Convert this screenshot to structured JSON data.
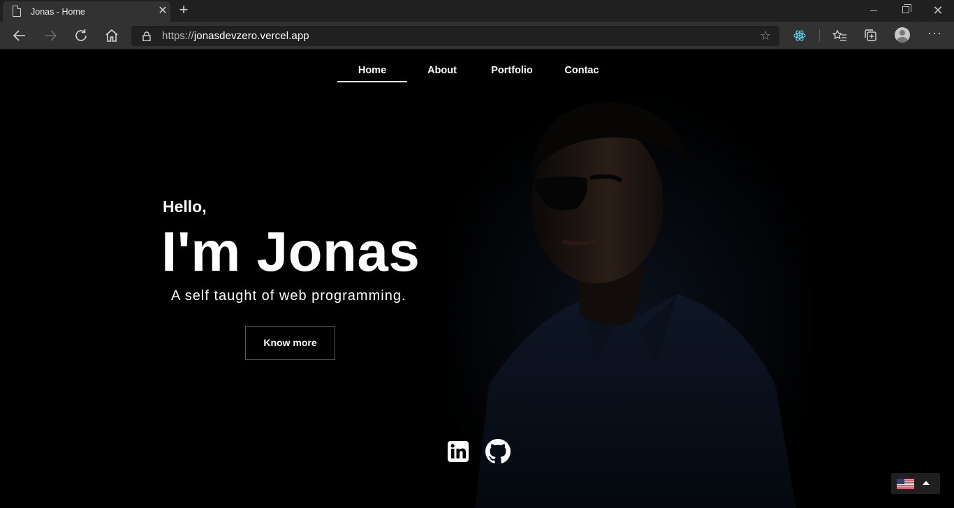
{
  "browser": {
    "tab_title": "Jonas - Home",
    "url_scheme": "https://",
    "url_host": "jonasdevzero.vercel.app",
    "icons": {
      "back": "back-arrow-icon",
      "forward": "forward-arrow-icon",
      "refresh": "refresh-icon",
      "home": "home-icon",
      "lock": "lock-icon",
      "favorite": "star-icon",
      "extension": "react-devtools-icon",
      "favorites_list": "favorites-list-icon",
      "collections": "collections-icon",
      "profile": "profile-icon",
      "more": "more-icon"
    }
  },
  "nav": {
    "items": [
      {
        "label": "Home",
        "active": true
      },
      {
        "label": "About",
        "active": false
      },
      {
        "label": "Portfolio",
        "active": false
      },
      {
        "label": "Contac",
        "active": false
      }
    ]
  },
  "hero": {
    "greeting": "Hello,",
    "name": "I'm Jonas",
    "tagline": "A self taught of web programming.",
    "cta_label": "Know more",
    "cta_border_color": "#e01e1e"
  },
  "social": {
    "links": [
      {
        "icon": "linkedin-icon"
      },
      {
        "icon": "github-icon"
      }
    ]
  },
  "language_selector": {
    "flag": "us-flag-icon"
  }
}
